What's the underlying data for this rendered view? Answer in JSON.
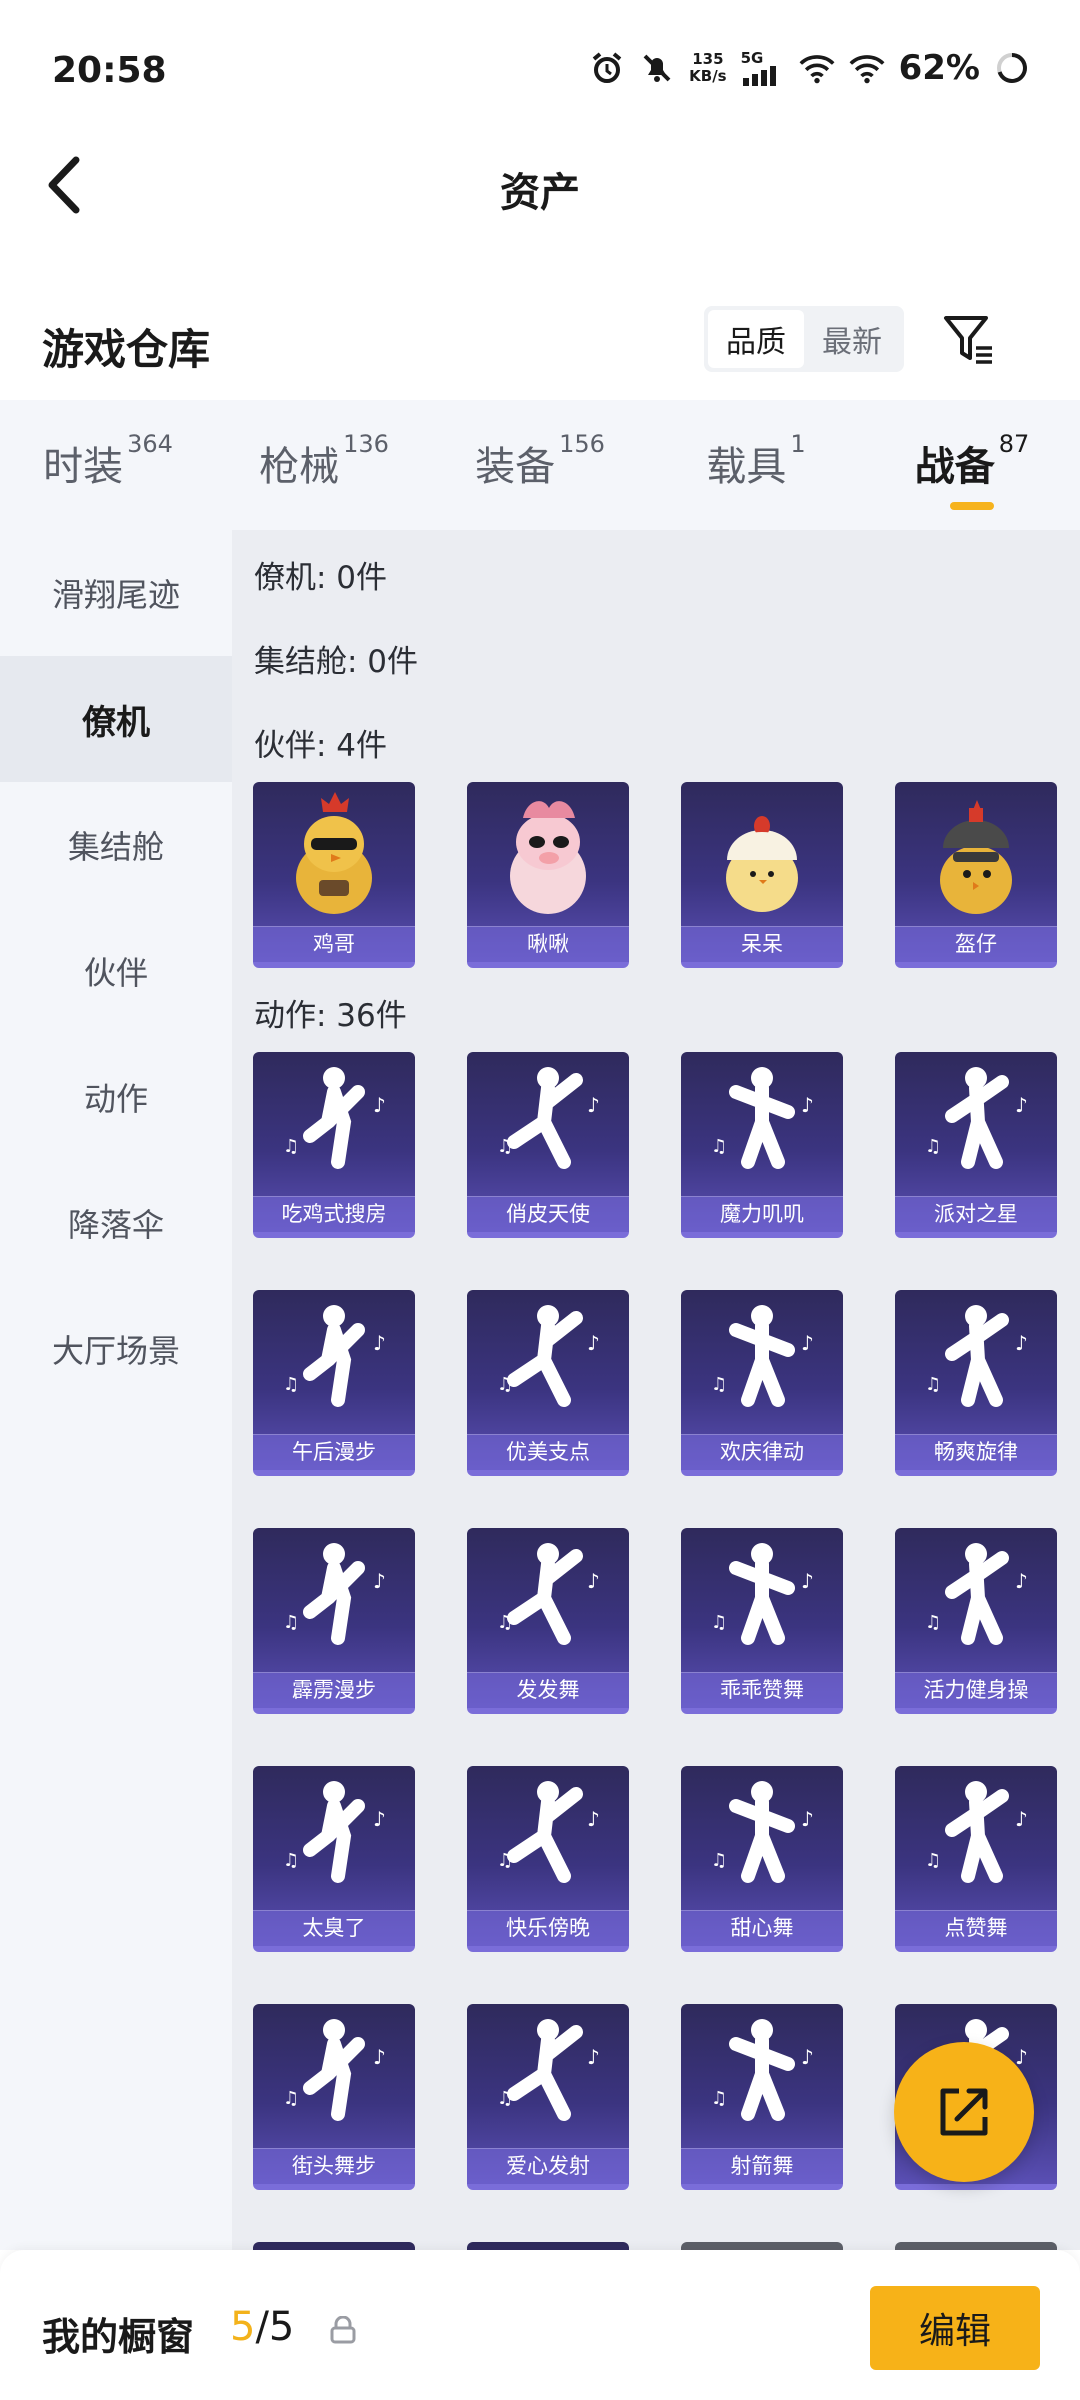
{
  "status_bar": {
    "time": "20:58",
    "net_speed_value": "135",
    "net_speed_unit": "KB/s",
    "network_type": "5G",
    "battery": "62%"
  },
  "header": {
    "title": "资产"
  },
  "warehouse": {
    "title": "游戏仓库",
    "sort_options": [
      "品质",
      "最新"
    ],
    "active_sort": "品质"
  },
  "categories": [
    {
      "label": "时装",
      "count": "364"
    },
    {
      "label": "枪械",
      "count": "136"
    },
    {
      "label": "装备",
      "count": "156"
    },
    {
      "label": "载具",
      "count": "1"
    },
    {
      "label": "战备",
      "count": "87"
    }
  ],
  "active_category": "战备",
  "sidebar": {
    "items": [
      "滑翔尾迹",
      "僚机",
      "集结舱",
      "伙伴",
      "动作",
      "降落伞",
      "大厅场景"
    ],
    "active": "僚机"
  },
  "sections": {
    "wingman": "僚机: 0件",
    "capsule": "集结舱: 0件",
    "companion": "伙伴: 4件",
    "emote": "动作: 36件"
  },
  "companions": [
    "鸡哥",
    "啾啾",
    "呆呆",
    "盔仔"
  ],
  "emotes": [
    "吃鸡式搜房",
    "俏皮天使",
    "魔力叽叽",
    "派对之星",
    "午后漫步",
    "优美支点",
    "欢庆律动",
    "畅爽旋律",
    "霹雳漫步",
    "发发舞",
    "乖乖赞舞",
    "活力健身操",
    "太臭了",
    "快乐傍晚",
    "甜心舞",
    "点赞舞",
    "街头舞步",
    "爱心发射",
    "射箭舞",
    ""
  ],
  "bottom_bar": {
    "label": "我的橱窗",
    "current": "5",
    "total": "/5",
    "edit_label": "编辑"
  },
  "colors": {
    "accent": "#f7b218",
    "card_purple": "#3b3480"
  }
}
